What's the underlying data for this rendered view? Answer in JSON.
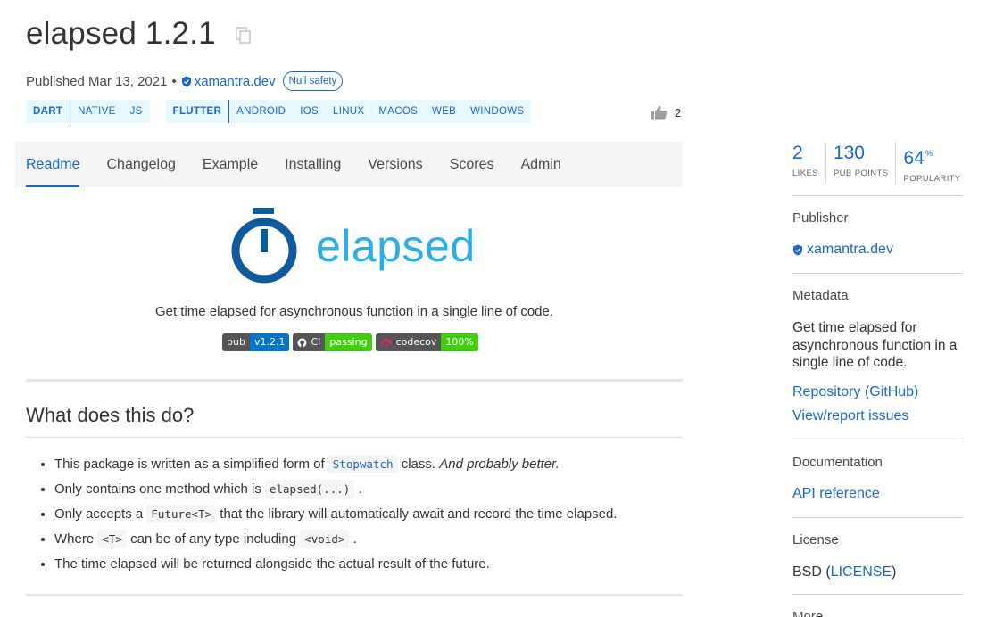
{
  "package": {
    "title": "elapsed 1.2.1",
    "published": "Published Mar 13, 2021",
    "separator": "•",
    "publisher": "xamantra.dev",
    "null_safety": "Null safety"
  },
  "tags": {
    "dart_group": {
      "head": "DART",
      "items": [
        "NATIVE",
        "JS"
      ]
    },
    "flutter_group": {
      "head": "FLUTTER",
      "items": [
        "ANDROID",
        "IOS",
        "LINUX",
        "MACOS",
        "WEB",
        "WINDOWS"
      ]
    }
  },
  "likes_count": "2",
  "tabs": [
    "Readme",
    "Changelog",
    "Example",
    "Installing",
    "Versions",
    "Scores",
    "Admin"
  ],
  "readme": {
    "logo_text": "elapsed",
    "description": "Get time elapsed for asynchronous function in a single line of code.",
    "badges": [
      {
        "left": "pub",
        "right": "v1.2.1",
        "color": "#0175c2"
      },
      {
        "left": "CI",
        "right": "passing",
        "color": "#44cc11"
      },
      {
        "left": "codecov",
        "right": "100%",
        "color": "#44cc11"
      }
    ],
    "heading": "What does this do?",
    "bullets": {
      "b1_pre": "This package is written as a simplified form of",
      "b1_code": "Stopwatch",
      "b1_post": "class.",
      "b1_em": "And probably better.",
      "b2_pre": "Only contains one method which is",
      "b2_code": "elapsed(...)",
      "b2_post": ".",
      "b3_pre": "Only accepts a",
      "b3_code": "Future<T>",
      "b3_post": "that the library will automatically await and record the time elapsed.",
      "b4_pre": "Where",
      "b4_code1": "<T>",
      "b4_mid": "can be of any type including",
      "b4_code2": "<void>",
      "b4_post": ".",
      "b5": "The time elapsed will be returned alongside the actual result of the future."
    }
  },
  "sidebar": {
    "stats": [
      {
        "value": "2",
        "label": "LIKES"
      },
      {
        "value": "130",
        "label": "PUB POINTS"
      },
      {
        "value": "64",
        "suffix": "%",
        "label": "POPULARITY"
      }
    ],
    "publisher_heading": "Publisher",
    "publisher": "xamantra.dev",
    "metadata_heading": "Metadata",
    "metadata_desc": "Get time elapsed for asynchronous function in a single line of code.",
    "repository": "Repository (GitHub)",
    "issues": "View/report issues",
    "documentation_heading": "Documentation",
    "api_reference": "API reference",
    "license_heading": "License",
    "license_pre": "BSD (",
    "license_link": "LICENSE",
    "license_post": ")",
    "more_heading": "More"
  },
  "colors": {
    "accent": "#1967d2",
    "logo": "#2aaee7",
    "logo_dark": "#0e5a9b"
  }
}
